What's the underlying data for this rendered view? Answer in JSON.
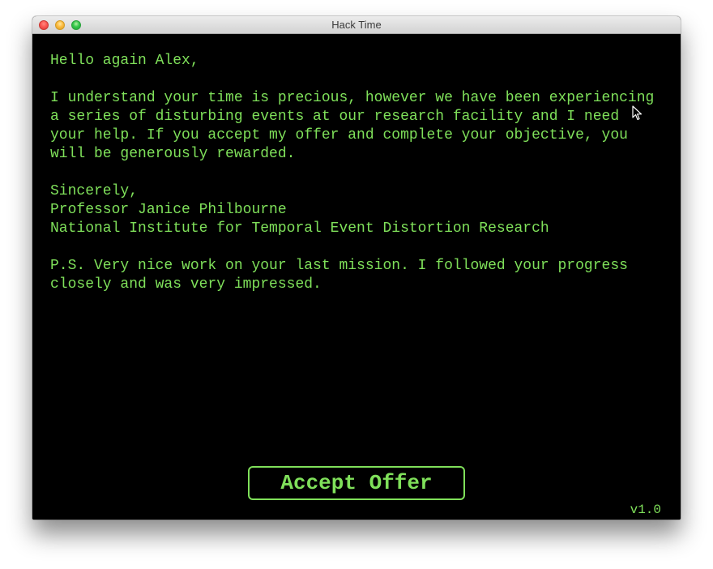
{
  "window": {
    "title": "Hack Time"
  },
  "message": {
    "greeting": "Hello again Alex,",
    "body_lines": [
      "I understand your time is precious, however we have been experiencing",
      "a series of disturbing events at our research facility and I need",
      "your help. If you accept my offer and complete your objective, you",
      "will be generously rewarded."
    ],
    "signoff": "Sincerely,",
    "signer_name": "Professor Janice Philbourne",
    "signer_org": "National Institute for Temporal Event Distortion Research",
    "ps_lines": [
      "P.S. Very nice work on your last mission. I followed your progress",
      "closely and was very impressed."
    ]
  },
  "actions": {
    "accept_label": "Accept Offer"
  },
  "footer": {
    "version": "v1.0"
  },
  "colors": {
    "terminal_green": "#7fe05a",
    "background": "#000000"
  },
  "icons": {
    "cursor": "arrow-cursor-icon",
    "close": "close-window-icon",
    "minimize": "minimize-window-icon",
    "zoom": "zoom-window-icon"
  }
}
